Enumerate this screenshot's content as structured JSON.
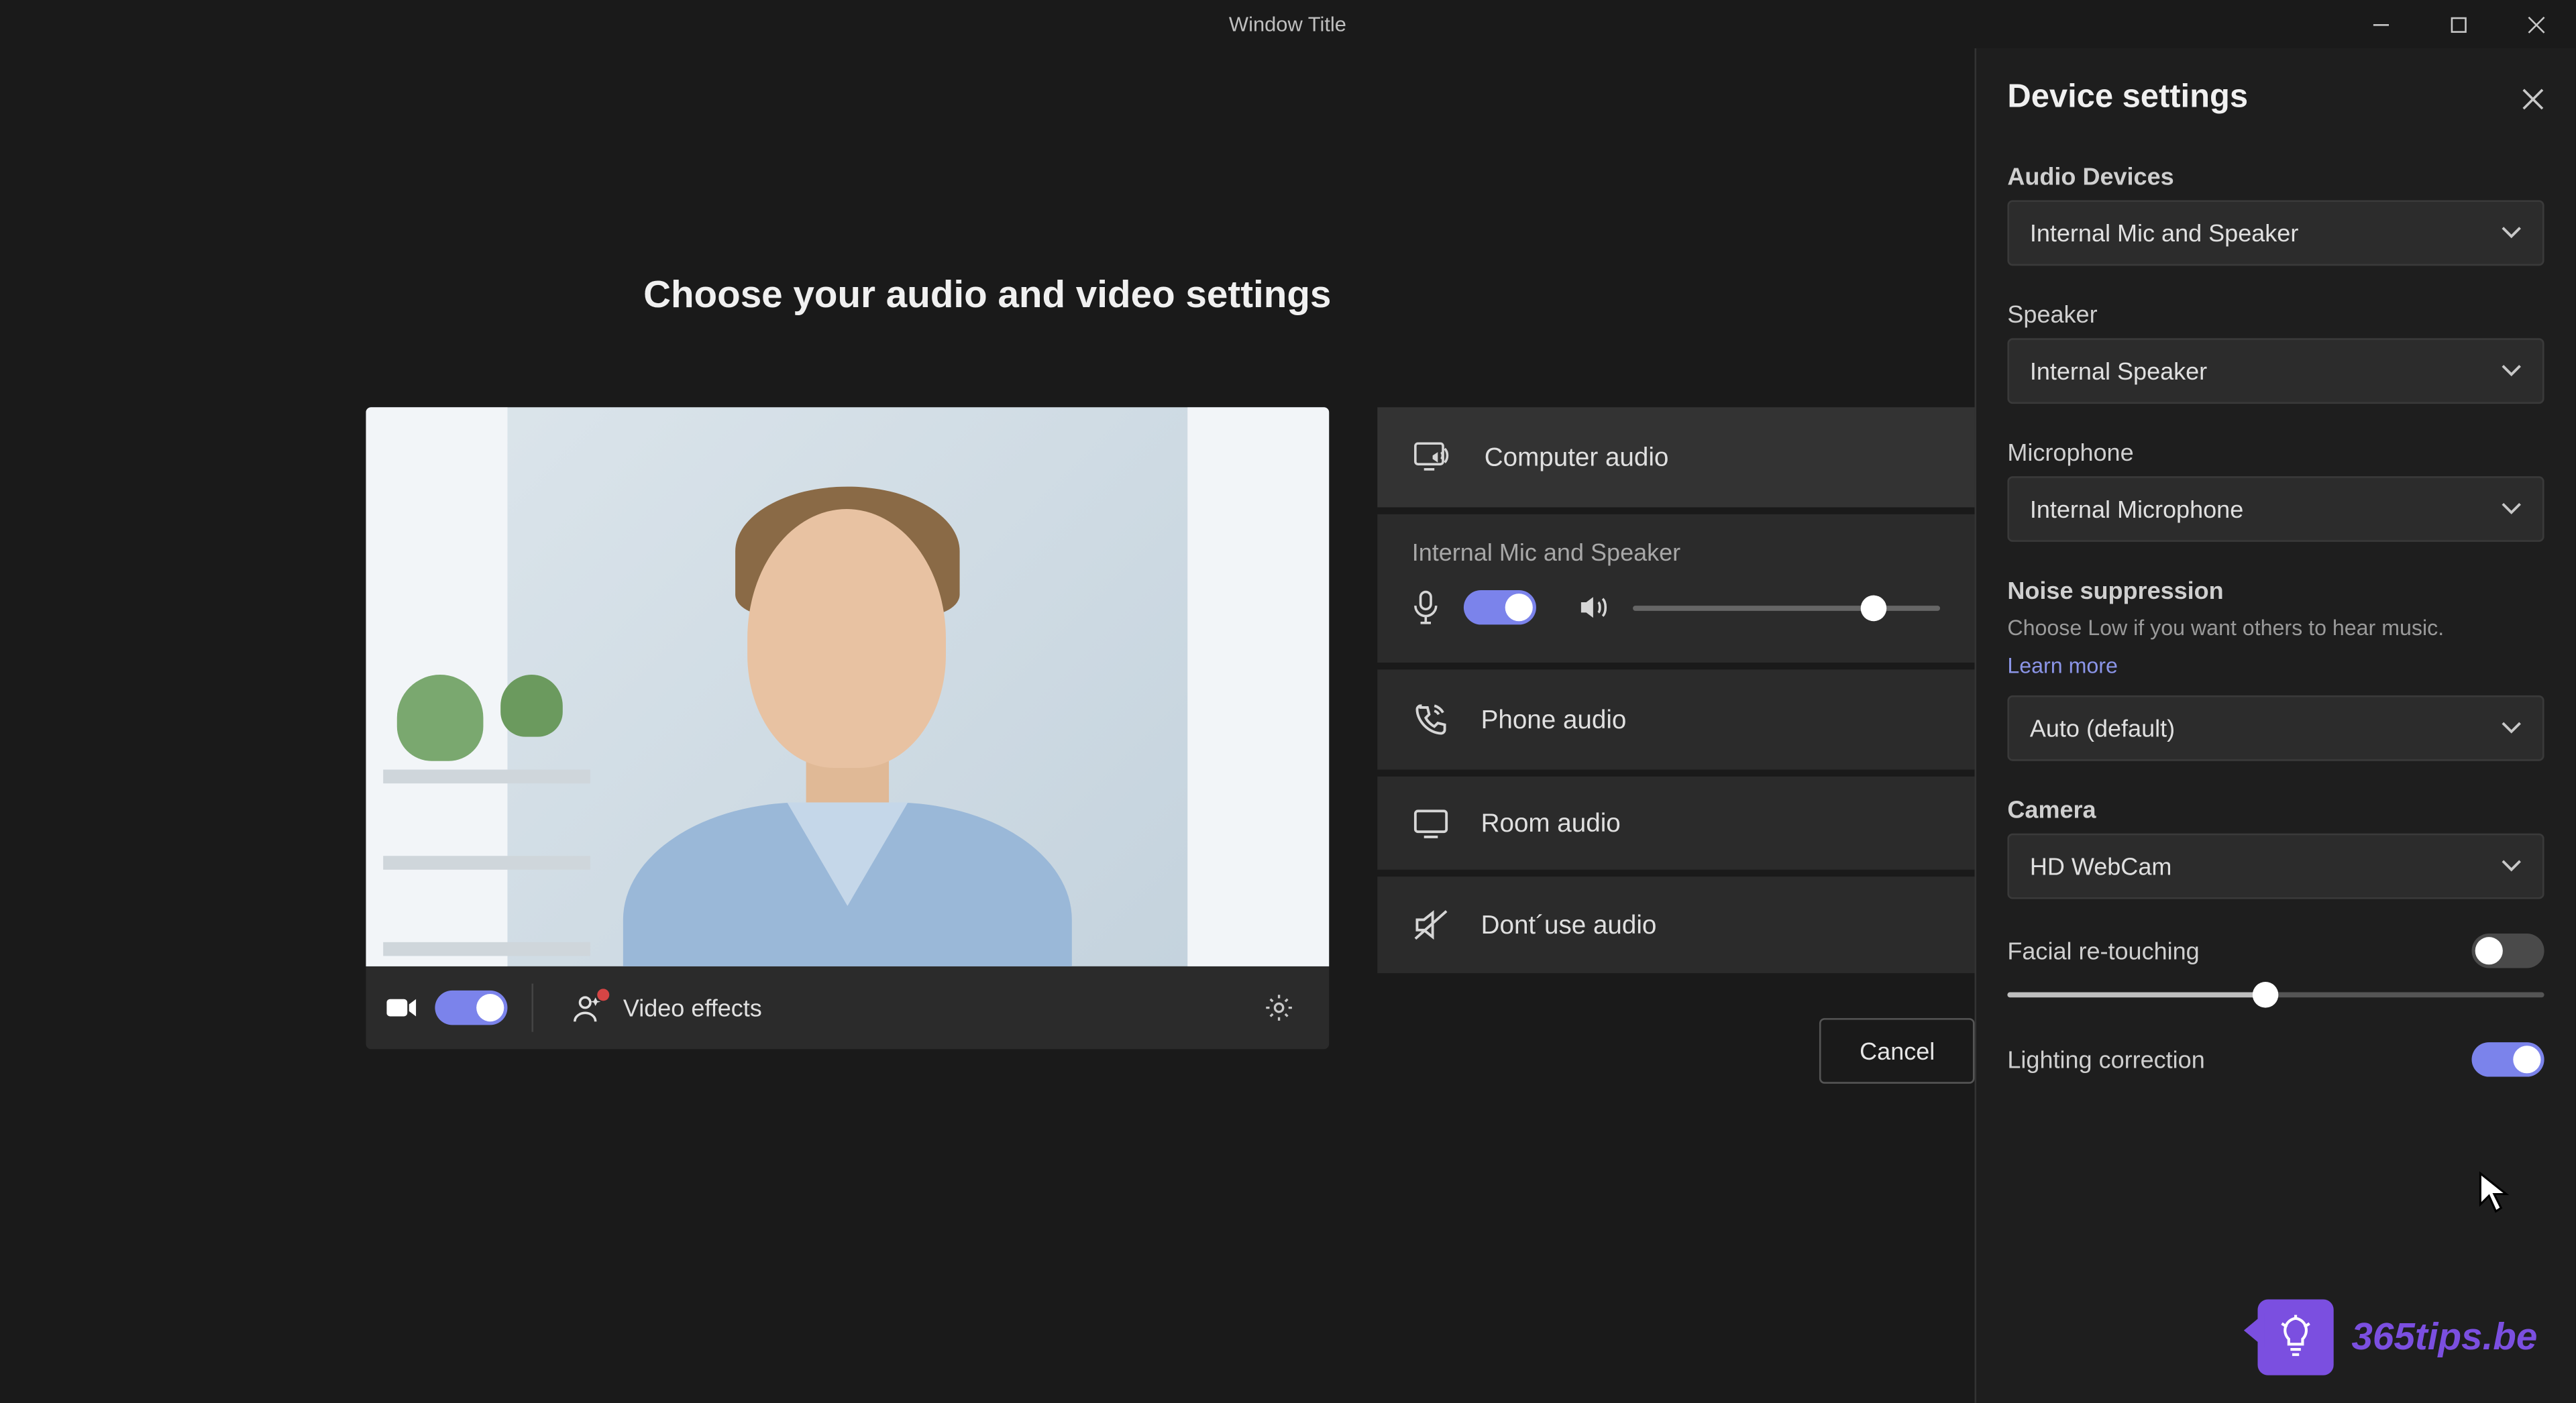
{
  "window": {
    "title": "Window Title"
  },
  "main": {
    "heading": "Choose your audio and video settings",
    "video_effects_label": "Video effects",
    "cancel_label": "Cancel"
  },
  "audio_options": {
    "computer": "Computer audio",
    "sub_label": "Internal Mic and Speaker",
    "phone": "Phone audio",
    "room": "Room audio",
    "none": "Dont´use audio",
    "volume_percent": 78
  },
  "panel": {
    "title": "Device settings",
    "audio_devices": {
      "label": "Audio Devices",
      "value": "Internal Mic and Speaker"
    },
    "speaker": {
      "label": "Speaker",
      "value": "Internal Speaker"
    },
    "microphone": {
      "label": "Microphone",
      "value": "Internal Microphone"
    },
    "noise": {
      "label": "Noise suppression",
      "help": "Choose Low if you want others to hear music.",
      "link": "Learn more",
      "value": "Auto (default)"
    },
    "camera": {
      "label": "Camera",
      "value": "HD WebCam"
    },
    "facial": {
      "label": "Facial re-touching",
      "slider_percent": 48,
      "enabled": false
    },
    "lighting": {
      "label": "Lighting correction",
      "enabled": true
    }
  },
  "watermark": "365tips.be"
}
